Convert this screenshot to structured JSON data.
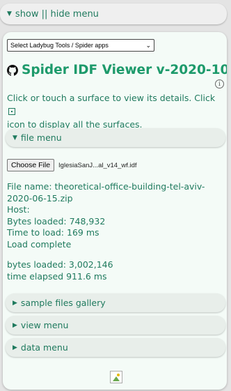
{
  "top_menu": {
    "label": "show || hide menu"
  },
  "select": {
    "value": "Select Ladybug Tools / Spider apps"
  },
  "app": {
    "title": "Spider IDF Viewer v-2020-10-09"
  },
  "intro": {
    "part1": "Click or touch a surface to view its details. Click",
    "part2": "icon to display all the surfaces."
  },
  "file_menu": {
    "label": "file menu"
  },
  "file_input": {
    "button": "Choose File",
    "filename": "IglesiaSanJ...al_v14_wf.idf"
  },
  "file_info": {
    "file_name": "File name: theoretical-office-building-tel-aviv-2020-06-15.zip",
    "host": "Host:",
    "bytes_loaded": "Bytes loaded: 748,932",
    "time_to_load": "Time to load: 169 ms",
    "status": "Load complete"
  },
  "stats": {
    "bytes_loaded": "bytes loaded: 3,002,146",
    "time_elapsed": "time elapsed 911.6 ms"
  },
  "menus": {
    "sample_files": "sample files gallery",
    "view": "view menu",
    "data": "data menu"
  },
  "colors": {
    "accent": "#1d9a6b",
    "text": "#1f7a5e"
  }
}
